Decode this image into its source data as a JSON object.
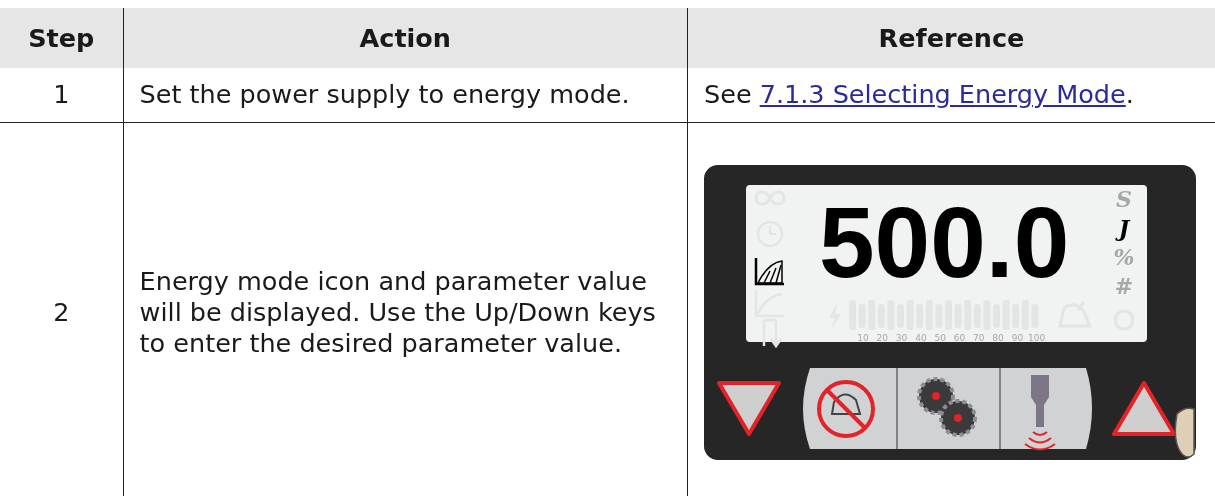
{
  "table": {
    "columns": [
      "Step",
      "Action",
      "Reference"
    ],
    "rows": [
      {
        "step": "1",
        "action": "Set the power supply to energy mode.",
        "reference": {
          "kind": "link",
          "prefix": "See ",
          "link": "7.1.3 Selecting Energy Mode",
          "suffix": "."
        }
      },
      {
        "step": "2",
        "action": "Energy mode icon and parameter value will be displayed. Use the Up/Down keys to enter the desired parameter value.",
        "reference": {
          "kind": "figure",
          "display": {
            "value": "500.0",
            "modes": [
              {
                "kind": "continuous",
                "lit": false
              },
              {
                "kind": "time",
                "lit": false
              },
              {
                "kind": "energy",
                "lit": true
              },
              {
                "kind": "power",
                "lit": false
              },
              {
                "kind": "ground",
                "lit": false
              }
            ],
            "units": [
              {
                "label": "S",
                "lit": false
              },
              {
                "label": "J",
                "lit": true
              },
              {
                "label": "%",
                "lit": false
              },
              {
                "label": "#",
                "lit": false
              }
            ],
            "scale_labels": [
              "10",
              "20",
              "30",
              "40",
              "50",
              "60",
              "70",
              "80",
              "90",
              "100"
            ]
          }
        }
      }
    ]
  }
}
